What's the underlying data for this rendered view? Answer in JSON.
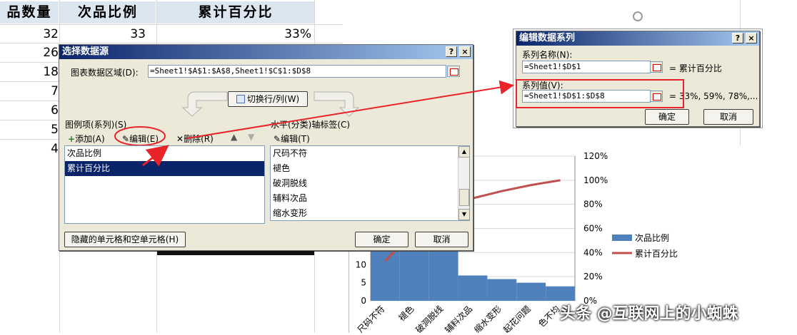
{
  "sheet": {
    "headers": [
      "品数量",
      "次品比例",
      "累计百分比"
    ],
    "col1_values": [
      "32",
      "26",
      "18",
      "7",
      "6",
      "5",
      "4"
    ],
    "col2_values": [
      "33"
    ],
    "col3_values": [
      "33%"
    ]
  },
  "select_source": {
    "title": "选择数据源",
    "help": "?",
    "close": "×",
    "range_label": "图表数据区域(D):",
    "range_value": "=Sheet1!$A$1:$A$8,Sheet1!$C$1:$D$8",
    "switch_label": "切换行/列(W)",
    "legend_label": "图例项(系列)(S)",
    "add_label": "添加(A)",
    "edit_label": "编辑(E)",
    "delete_label": "删除(R)",
    "up_arrow": "▲",
    "down_arrow": "▼",
    "series": [
      "次品比例",
      "累计百分比"
    ],
    "axis_label": "水平(分类)轴标签(C)",
    "axis_edit_label": "编辑(T)",
    "categories": [
      "尺码不符",
      "褪色",
      "破洞脱线",
      "辅料次品",
      "缩水变形"
    ],
    "hidden_cells_label": "隐藏的单元格和空单元格(H)",
    "ok": "确定",
    "cancel": "取消"
  },
  "edit_series": {
    "title": "编辑数据系列",
    "help": "?",
    "close": "×",
    "name_label": "系列名称(N):",
    "name_value": "=Sheet1!$D$1",
    "name_result": "= 累计百分比",
    "values_label": "系列值(V):",
    "values_value": "=Sheet1!$D$1:$D$8",
    "values_result": "= 33%, 59%, 78%,...",
    "ok": "确定",
    "cancel": "取消"
  },
  "chart_data": {
    "type": "bar",
    "categories": [
      "尺码不符",
      "褪色",
      "破洞脱线",
      "辅料次品",
      "缩水变形",
      "起花问题",
      "色不均"
    ],
    "series": [
      {
        "name": "次品比例",
        "type": "bar",
        "color": "#4f81bd",
        "values": [
          32,
          26,
          18,
          7,
          6,
          5,
          4
        ]
      },
      {
        "name": "累计百分比",
        "type": "line",
        "color": "#c0504d",
        "values": [
          33,
          59,
          78,
          85,
          91,
          96,
          100
        ]
      }
    ],
    "y_ticks_left": [
      "0",
      "5",
      "10"
    ],
    "y_ticks_right": [
      "0%",
      "20%",
      "40%",
      "60%",
      "80%",
      "100%",
      "120%"
    ],
    "ylim_left": [
      0,
      40
    ],
    "ylim_right": [
      0,
      120
    ],
    "legend": "right"
  },
  "watermark": "头条 @互联网上的小蜘蛛",
  "colors": {
    "header_bg": "#dce6f1",
    "title_bar": "#0a246a",
    "highlight": "#e8242a"
  }
}
